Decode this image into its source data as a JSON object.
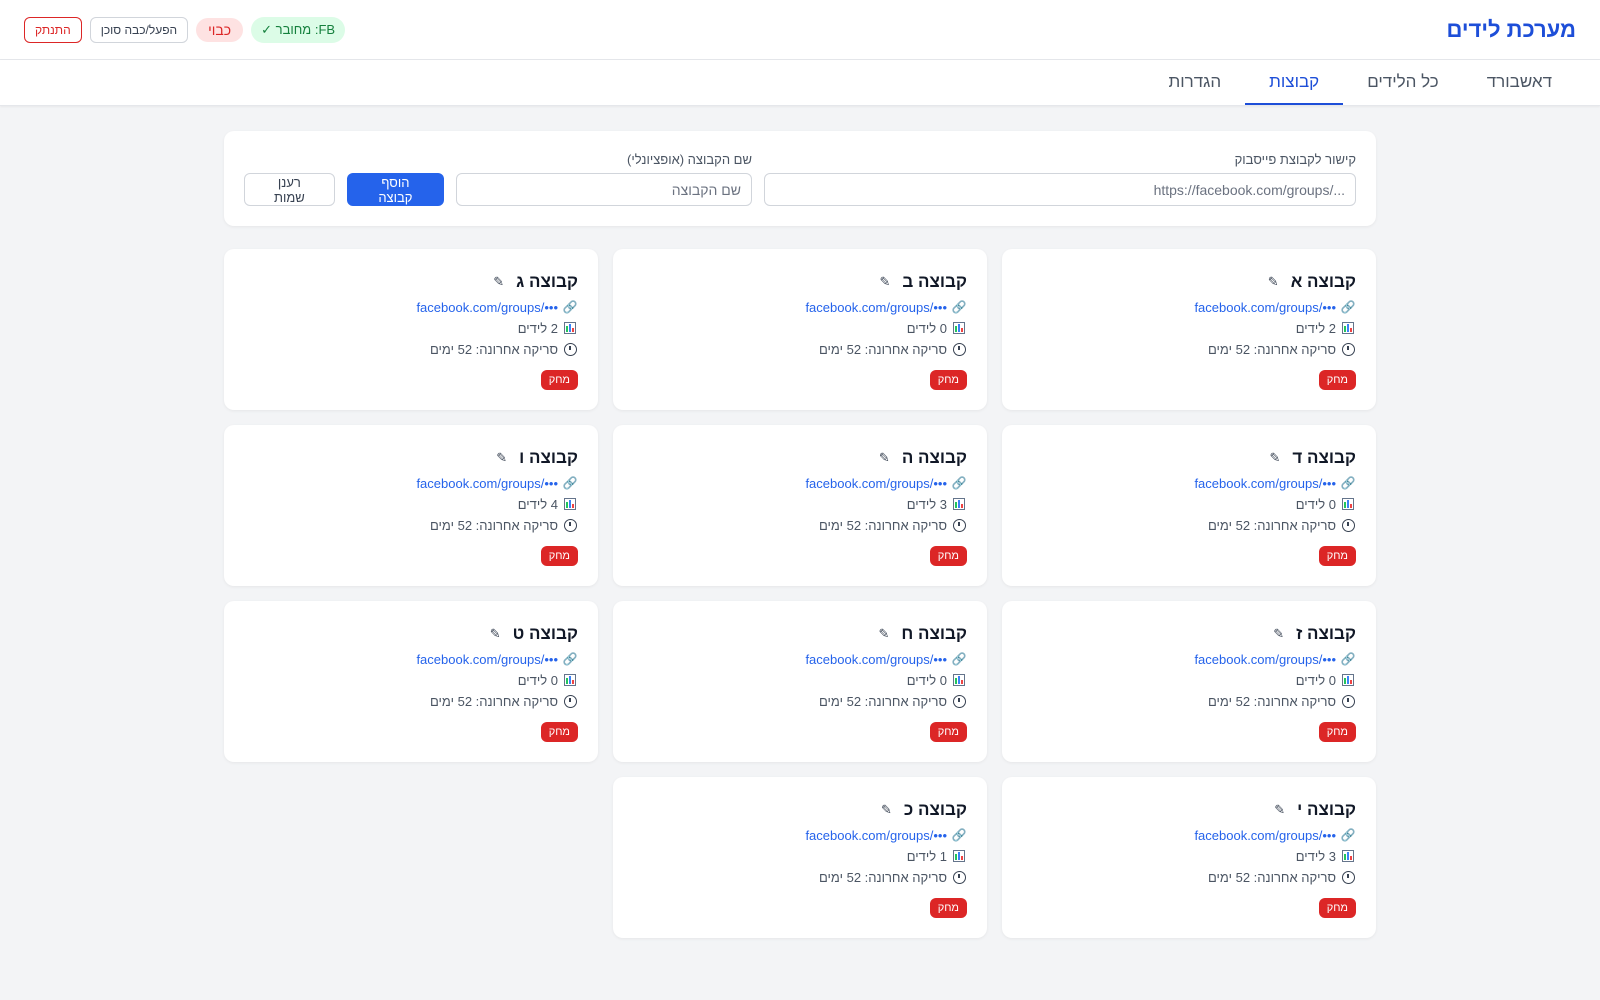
{
  "header": {
    "title": "מערכת לידים",
    "fb_status": "FB: מחובר ✓",
    "agent_status": "כבוי",
    "toggle_agent": "הפעל/כבה סוכן",
    "logout": "התנתק"
  },
  "tabs": [
    "דאשבורד",
    "כל הלידים",
    "קבוצות",
    "הגדרות"
  ],
  "active_tab": 2,
  "add_form": {
    "url_label": "קישור לקבוצת פייסבוק",
    "url_placeholder": "https://facebook.com/groups/...",
    "name_label": "שם הקבוצה (אופציונלי)",
    "name_placeholder": "שם הקבוצה",
    "add_button": "הוסף קבוצה",
    "refresh_button": "רענן שמות"
  },
  "groups": [
    {
      "name": "קבוצה א",
      "url": "facebook.com/groups/•••",
      "leads": "2 לידים",
      "last_scan": "סריקה אחרונה: 52 ימים",
      "delete": "מחק"
    },
    {
      "name": "קבוצה ב",
      "url": "facebook.com/groups/•••",
      "leads": "0 לידים",
      "last_scan": "סריקה אחרונה: 52 ימים",
      "delete": "מחק"
    },
    {
      "name": "קבוצה ג",
      "url": "facebook.com/groups/•••",
      "leads": "2 לידים",
      "last_scan": "סריקה אחרונה: 52 ימים",
      "delete": "מחק"
    },
    {
      "name": "קבוצה ד",
      "url": "facebook.com/groups/•••",
      "leads": "0 לידים",
      "last_scan": "סריקה אחרונה: 52 ימים",
      "delete": "מחק"
    },
    {
      "name": "קבוצה ה",
      "url": "facebook.com/groups/•••",
      "leads": "3 לידים",
      "last_scan": "סריקה אחרונה: 52 ימים",
      "delete": "מחק"
    },
    {
      "name": "קבוצה ו",
      "url": "facebook.com/groups/•••",
      "leads": "4 לידים",
      "last_scan": "סריקה אחרונה: 52 ימים",
      "delete": "מחק"
    },
    {
      "name": "קבוצה ז",
      "url": "facebook.com/groups/•••",
      "leads": "0 לידים",
      "last_scan": "סריקה אחרונה: 52 ימים",
      "delete": "מחק"
    },
    {
      "name": "קבוצה ח",
      "url": "facebook.com/groups/•••",
      "leads": "0 לידים",
      "last_scan": "סריקה אחרונה: 52 ימים",
      "delete": "מחק"
    },
    {
      "name": "קבוצה ט",
      "url": "facebook.com/groups/•••",
      "leads": "0 לידים",
      "last_scan": "סריקה אחרונה: 52 ימים",
      "delete": "מחק"
    },
    {
      "name": "קבוצה י",
      "url": "facebook.com/groups/•••",
      "leads": "3 לידים",
      "last_scan": "סריקה אחרונה: 52 ימים",
      "delete": "מחק"
    },
    {
      "name": "קבוצה כ",
      "url": "facebook.com/groups/•••",
      "leads": "1 לידים",
      "last_scan": "סריקה אחרונה: 52 ימים",
      "delete": "מחק"
    }
  ],
  "icons": {
    "edit": "pencil-icon",
    "link": "link-icon",
    "leads": "bar-chart-icon",
    "last_scan": "clock-icon"
  },
  "colors": {
    "brand": "#1d4ed8",
    "primary_button": "#2563eb",
    "delete_button": "#dc2626",
    "fb_connected_bg": "#dcfce7",
    "agent_off_bg": "#fee2e2"
  }
}
